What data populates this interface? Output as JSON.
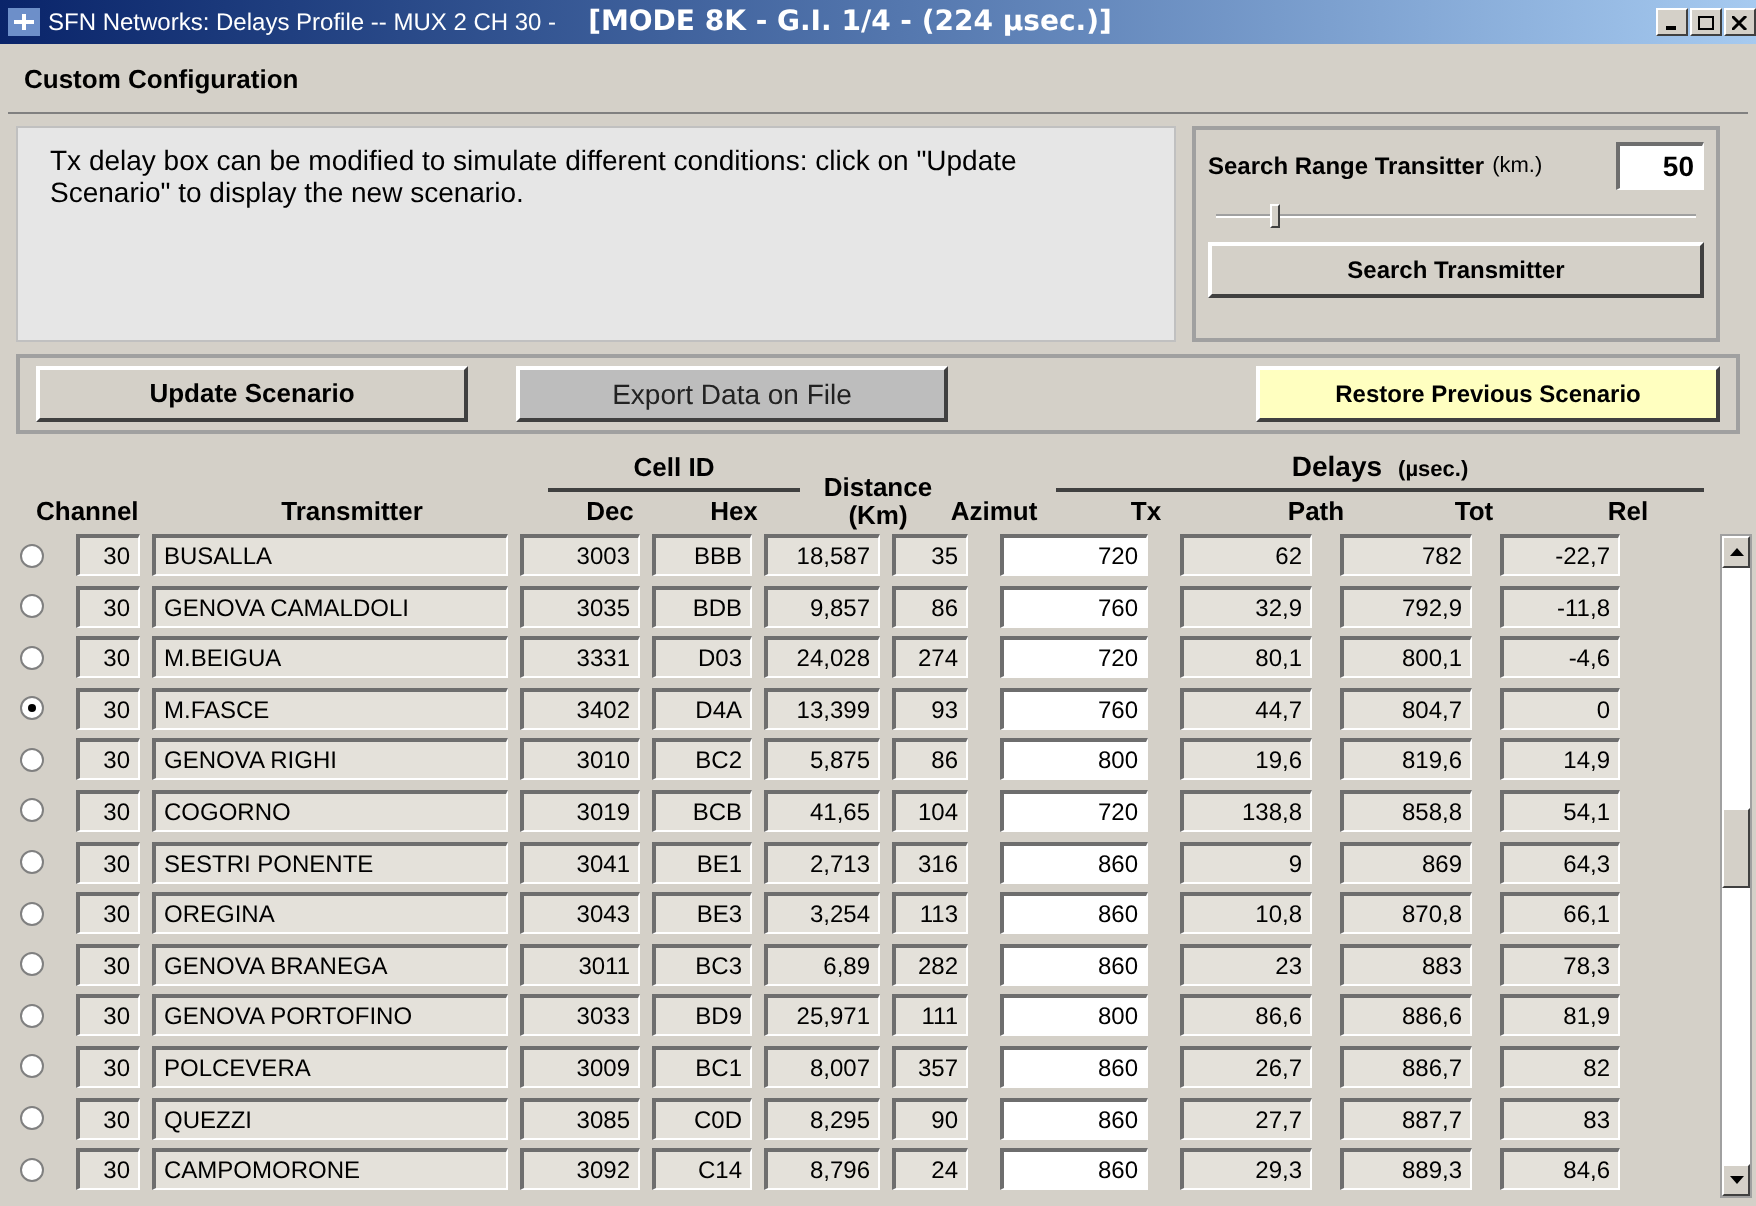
{
  "window": {
    "title": "SFN Networks: Delays Profile -- MUX 2 CH 30 -",
    "mode": "[MODE 8K - G.I. 1/4 - (224 µsec.)]"
  },
  "section_title": "Custom Configuration",
  "info_text": "Tx delay box can be modified to simulate different conditions: click on \"Update Scenario\" to display the new scenario.",
  "search": {
    "label": "Search Range Transitter",
    "unit": "(km.)",
    "value": "50",
    "level": 0.12,
    "button": "Search Transmitter"
  },
  "buttons": [
    {
      "label": "Update Scenario",
      "kind": "bold"
    },
    {
      "label": "Export Data on File",
      "kind": "grey"
    },
    {
      "label": "Restore Previous Scenario",
      "kind": "yellow"
    }
  ],
  "table": {
    "group_cell_id": "Cell ID",
    "group_delays": "Delays",
    "delays_unit": "(µsec.)",
    "columns": [
      "Channel",
      "Transmitter",
      "Dec",
      "Hex",
      "Distance",
      "(Km)",
      "Azimut",
      "Tx",
      "Path",
      "Tot",
      "Rel"
    ],
    "rows": [
      {
        "selected": false,
        "channel": "30",
        "transmitter": "BUSALLA",
        "dec": "3003",
        "hex": "BBB",
        "distance": "18,587",
        "azimut": "35",
        "tx": "720",
        "path": "62",
        "tot": "782",
        "rel": "-22,7"
      },
      {
        "selected": false,
        "channel": "30",
        "transmitter": "GENOVA CAMALDOLI",
        "dec": "3035",
        "hex": "BDB",
        "distance": "9,857",
        "azimut": "86",
        "tx": "760",
        "path": "32,9",
        "tot": "792,9",
        "rel": "-11,8"
      },
      {
        "selected": false,
        "channel": "30",
        "transmitter": "M.BEIGUA",
        "dec": "3331",
        "hex": "D03",
        "distance": "24,028",
        "azimut": "274",
        "tx": "720",
        "path": "80,1",
        "tot": "800,1",
        "rel": "-4,6"
      },
      {
        "selected": true,
        "channel": "30",
        "transmitter": "M.FASCE",
        "dec": "3402",
        "hex": "D4A",
        "distance": "13,399",
        "azimut": "93",
        "tx": "760",
        "path": "44,7",
        "tot": "804,7",
        "rel": "0"
      },
      {
        "selected": false,
        "channel": "30",
        "transmitter": "GENOVA RIGHI",
        "dec": "3010",
        "hex": "BC2",
        "distance": "5,875",
        "azimut": "86",
        "tx": "800",
        "path": "19,6",
        "tot": "819,6",
        "rel": "14,9"
      },
      {
        "selected": false,
        "channel": "30",
        "transmitter": "COGORNO",
        "dec": "3019",
        "hex": "BCB",
        "distance": "41,65",
        "azimut": "104",
        "tx": "720",
        "path": "138,8",
        "tot": "858,8",
        "rel": "54,1"
      },
      {
        "selected": false,
        "channel": "30",
        "transmitter": "SESTRI PONENTE",
        "dec": "3041",
        "hex": "BE1",
        "distance": "2,713",
        "azimut": "316",
        "tx": "860",
        "path": "9",
        "tot": "869",
        "rel": "64,3"
      },
      {
        "selected": false,
        "channel": "30",
        "transmitter": "OREGINA",
        "dec": "3043",
        "hex": "BE3",
        "distance": "3,254",
        "azimut": "113",
        "tx": "860",
        "path": "10,8",
        "tot": "870,8",
        "rel": "66,1"
      },
      {
        "selected": false,
        "channel": "30",
        "transmitter": "GENOVA BRANEGA",
        "dec": "3011",
        "hex": "BC3",
        "distance": "6,89",
        "azimut": "282",
        "tx": "860",
        "path": "23",
        "tot": "883",
        "rel": "78,3"
      },
      {
        "selected": false,
        "channel": "30",
        "transmitter": "GENOVA PORTOFINO",
        "dec": "3033",
        "hex": "BD9",
        "distance": "25,971",
        "azimut": "111",
        "tx": "800",
        "path": "86,6",
        "tot": "886,6",
        "rel": "81,9"
      },
      {
        "selected": false,
        "channel": "30",
        "transmitter": "POLCEVERA",
        "dec": "3009",
        "hex": "BC1",
        "distance": "8,007",
        "azimut": "357",
        "tx": "860",
        "path": "26,7",
        "tot": "886,7",
        "rel": "82"
      },
      {
        "selected": false,
        "channel": "30",
        "transmitter": "QUEZZI",
        "dec": "3085",
        "hex": "C0D",
        "distance": "8,295",
        "azimut": "90",
        "tx": "860",
        "path": "27,7",
        "tot": "887,7",
        "rel": "83"
      },
      {
        "selected": false,
        "channel": "30",
        "transmitter": "CAMPOMORONE",
        "dec": "3092",
        "hex": "C14",
        "distance": "8,796",
        "azimut": "24",
        "tx": "860",
        "path": "29,3",
        "tot": "889,3",
        "rel": "84,6"
      }
    ]
  }
}
